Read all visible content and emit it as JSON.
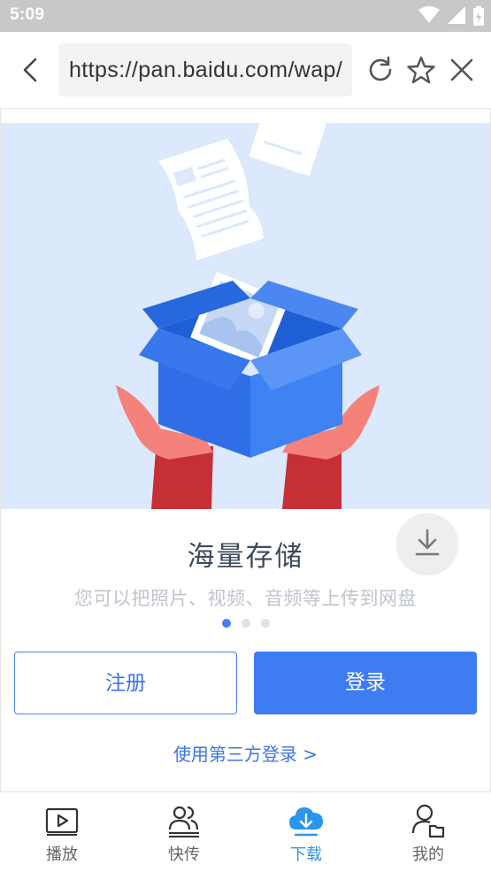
{
  "status_bar": {
    "time": "5:09"
  },
  "browser": {
    "url": "https://pan.baidu.com/wap/"
  },
  "onboarding": {
    "title": "海量存储",
    "description": "您可以把照片、视频、音频等上传到网盘",
    "pages_total": 3,
    "page_active": 1
  },
  "actions": {
    "register_label": "注册",
    "login_label": "登录",
    "third_party_label": "使用第三方登录 >"
  },
  "bottom_nav": {
    "items": [
      {
        "label": "播放",
        "icon": "play-icon"
      },
      {
        "label": "快传",
        "icon": "users-icon"
      },
      {
        "label": "下载",
        "icon": "cloud-download-icon",
        "active": true
      },
      {
        "label": "我的",
        "icon": "profile-icon"
      }
    ]
  },
  "colors": {
    "accent": "#3e7cf2",
    "nav_active": "#2a95ef",
    "hero_bg": "#dce8fb"
  }
}
